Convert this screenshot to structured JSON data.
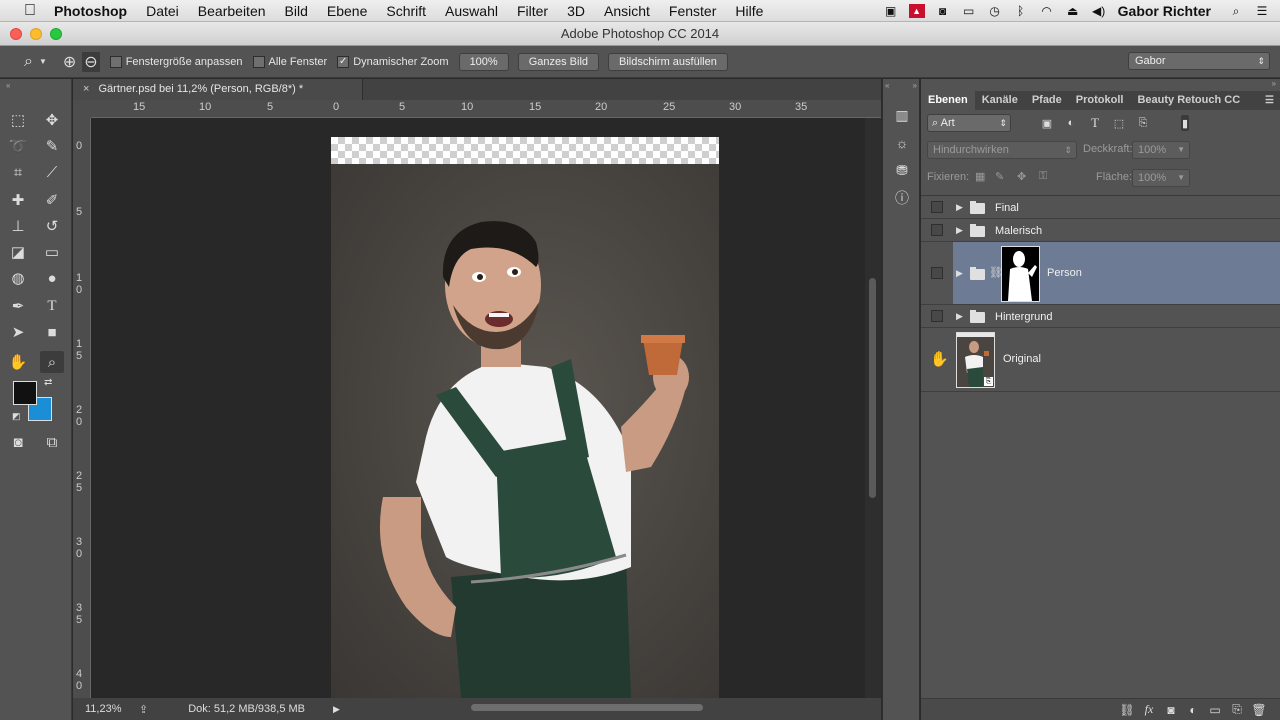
{
  "menubar": {
    "app_name": "Photoshop",
    "items": [
      "Datei",
      "Bearbeiten",
      "Bild",
      "Ebene",
      "Schrift",
      "Auswahl",
      "Filter",
      "3D",
      "Ansicht",
      "Fenster",
      "Hilfe"
    ],
    "user": "Gabor Richter"
  },
  "window": {
    "title": "Adobe Photoshop CC 2014"
  },
  "options_bar": {
    "fit_window_label": "Fenstergröße anpassen",
    "all_windows_label": "Alle Fenster",
    "scrubby_zoom_label": "Dynamischer Zoom",
    "zoom_100_label": "100%",
    "fit_screen_label": "Ganzes Bild",
    "fill_screen_label": "Bildschirm ausfüllen",
    "workspace": "Gabor"
  },
  "document": {
    "tab_title": "Gärtner.psd bei 11,2% (Person, RGB/8*) *",
    "close_glyph": "×",
    "ruler_h": [
      "15",
      "10",
      "5",
      "0",
      "5",
      "10",
      "15",
      "20",
      "25",
      "30",
      "35"
    ],
    "ruler_v": [
      "0",
      "5",
      "1 0",
      "1 5",
      "2 0",
      "2 5",
      "3 0",
      "3 5",
      "4 0"
    ]
  },
  "status": {
    "zoom": "11,23%",
    "doc_size": "Dok: 51,2 MB/938,5 MB"
  },
  "layers_panel": {
    "tabs": [
      "Ebenen",
      "Kanäle",
      "Pfade",
      "Protokoll",
      "Beauty Retouch CC"
    ],
    "filter_type": "Art",
    "blend_mode": "Hindurchwirken",
    "opacity_label": "Deckkraft:",
    "opacity_value": "100%",
    "lock_label": "Fixieren:",
    "fill_label": "Fläche:",
    "fill_value": "100%",
    "layers": [
      {
        "name": "Final"
      },
      {
        "name": "Malerisch"
      },
      {
        "name": "Person"
      },
      {
        "name": "Hintergrund"
      },
      {
        "name": "Original"
      }
    ]
  },
  "colors": {
    "foreground": "#111111",
    "background": "#1a8fd6",
    "selected_layer": "#6d7b94"
  }
}
